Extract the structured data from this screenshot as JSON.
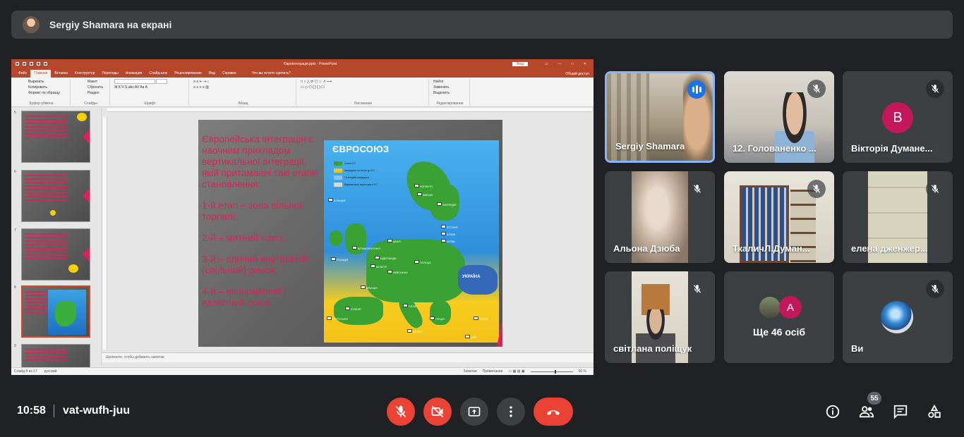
{
  "topbar": {
    "text": "Sergiy Shamara на екрані"
  },
  "powerpoint": {
    "doc_title": "Євроінтеграція.pptx - PowerPoint",
    "signin": "Вхід",
    "menu_tabs": [
      "Файл",
      "Главная",
      "Вставка",
      "Конструктор",
      "Переходы",
      "Анимация",
      "Слайд-шоу",
      "Рецензирование",
      "Вид",
      "Справка"
    ],
    "active_tab": "Главная",
    "tell_me": "Что вы хотите сделать?",
    "share": "Общий доступ",
    "ribbon_groups": [
      "Буфер обмена",
      "Слайды",
      "Шрифт",
      "Абзац",
      "Рисование",
      "Редактирование"
    ],
    "clipboard_items": [
      "Вырезать",
      "Копировать",
      "Формат по образцу"
    ],
    "slides_items": [
      "Макет",
      "Сбросить",
      "Раздел"
    ],
    "editing_items": [
      "Найти",
      "Заменить",
      "Выделить"
    ],
    "thumb_numbers": [
      "5",
      "6",
      "7",
      "8",
      "9"
    ],
    "notes_placeholder": "Щелкните, чтобы добавить заметки",
    "status_left": "Слайд 8 из 17",
    "status_lang": "русский",
    "status_notes": "Заметки",
    "status_comments": "Примечания",
    "zoom": "66 %"
  },
  "slide": {
    "paragraphs": [
      "Європейська інтеграція є наочним прикладом вертикальної інтеграції, якій притаманні такі етапи становлення:",
      "1-й етап – зона вільної торгівлі;",
      "2-й – митний союз;",
      "3-й – єдиний внутрішній (спільний) ринок;",
      "4-й – економічний і валютний союз."
    ],
    "map_title": "ЄВРОСОЮЗ",
    "legend": [
      "Члени ЄС",
      "Кандидати на вступ до ЄС",
      "Потенційні кандидати",
      "Відмовились від вступу в ЄС"
    ],
    "legend_colors": [
      "#3aa135",
      "#f4c21a",
      "#7fc7f0",
      "#d9d9d9"
    ],
    "ukraine_label": "УКРАЇНА",
    "countries": [
      "ІСЛАНДІЯ",
      "НОРВЕГІЯ",
      "ШВЕЦІЯ",
      "ФІНЛЯНДІЯ",
      "ЕСТОНІЯ",
      "ЛАТВІЯ",
      "ЛИТВА",
      "ДАНІЯ",
      "ВЕЛИКОБРИТАНІЯ",
      "ІРЛАНДІЯ",
      "НІДЕРЛАНДИ",
      "БЕЛЬГІЯ",
      "НІМЕЧЧИНА",
      "ПОЛЬЩА",
      "ФРАНЦІЯ",
      "ІСПАНІЯ",
      "ПОРТУГАЛІЯ",
      "ІТАЛІЯ",
      "ГРЕЦІЯ",
      "ТУРЦІЯ",
      "КІПР",
      "МАЛЬТА"
    ]
  },
  "participants": [
    {
      "name": "Sergiy Shamara",
      "speaking": true
    },
    {
      "name": "12. Голованенко ...",
      "muted": true
    },
    {
      "name": "Вікторія Думане...",
      "initial": "В",
      "muted": true,
      "avatar_color": "#c2185b"
    },
    {
      "name": "Альона Дзюба",
      "muted": true
    },
    {
      "name": "ТкаличЛ.Думан...",
      "muted": true
    },
    {
      "name": "елена дженжер...",
      "muted": true
    },
    {
      "name": "світлана поліщук",
      "muted": true
    },
    {
      "name": "Ще 46 осіб",
      "initial": "А",
      "avatar_color": "#c2185b"
    },
    {
      "name": "Ви",
      "muted": true
    }
  ],
  "bottom": {
    "time": "10:58",
    "meeting_code": "vat-wufh-juu",
    "people_count": "55"
  }
}
